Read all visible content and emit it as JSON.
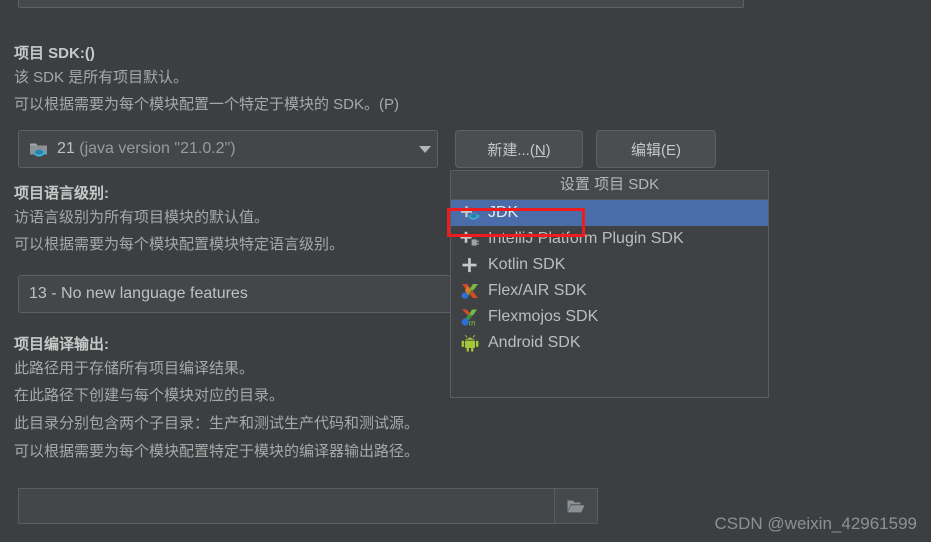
{
  "window": {
    "background_color": "#3c3f41",
    "text_color": "#a8a8a8"
  },
  "project_sdk": {
    "title": "项目 SDK:()",
    "desc_line1": "该 SDK 是所有项目默认。",
    "desc_line2": "可以根据需要为每个模块配置一个特定于模块的 SDK。(P)",
    "combo_value_main": "21",
    "combo_value_detail": "(java version \"21.0.2\")",
    "combo_icon": "jdk-folder-cup-icon",
    "new_button": "新建...(N)",
    "new_button_mnemonic": "N",
    "edit_button": "编辑(E)"
  },
  "language_level": {
    "title": "项目语言级别:",
    "desc_line1": "访语言级别为所有项目模块的默认值。",
    "desc_line2": "可以根据需要为每个模块配置模块特定语言级别。",
    "combo_value": "13 - No new language features"
  },
  "compiler_output": {
    "title": "项目编译输出:",
    "desc_line1": "此路径用于存储所有项目编译结果。",
    "desc_line2": "在此路径下创建与每个模块对应的目录。",
    "desc_line3": "此目录分别包含两个子目录：生产和测试生产代码和测试源。",
    "desc_line4": "可以根据需要为每个模块配置特定于模块的编译器输出路径。",
    "path_value": "",
    "path_placeholder": "",
    "browse_icon": "folder-open-icon"
  },
  "sdk_popup": {
    "header": "设置 项目 SDK",
    "selected_index": 0,
    "highlight_color": "#4a6ca8",
    "annotation_color": "#ee1c1c",
    "items": [
      {
        "label": "JDK",
        "icon": "add-jdk-icon",
        "selected": true
      },
      {
        "label": "IntelliJ Platform Plugin SDK",
        "icon": "add-plugin-sdk-icon",
        "selected": false
      },
      {
        "label": "Kotlin SDK",
        "icon": "add-plus-icon",
        "selected": false
      },
      {
        "label": "Flex/AIR SDK",
        "icon": "flex-air-icon",
        "selected": false
      },
      {
        "label": "Flexmojos SDK",
        "icon": "flexmojos-icon",
        "selected": false
      },
      {
        "label": "Android SDK",
        "icon": "android-icon",
        "selected": false
      }
    ]
  },
  "watermark": {
    "text": "CSDN @weixin_42961599"
  }
}
